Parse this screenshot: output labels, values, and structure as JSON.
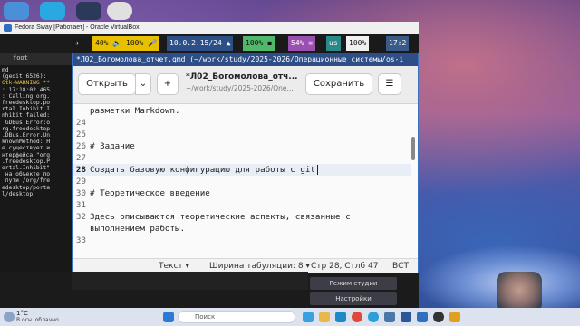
{
  "desktop": {
    "icons": [
      {
        "label": "Ko",
        "color": "#4a90d9"
      },
      {
        "label": "",
        "color": "#2aa8e0"
      },
      {
        "label": "",
        "color": "#2b3a5a"
      },
      {
        "label": "",
        "color": "#e0e0e0"
      },
      {
        "label": "",
        "color": "#c0392b"
      }
    ]
  },
  "vbox": {
    "title": "Fedora Sway [Работает] - Oracle VirtualBox",
    "controls": "— ❐ ✕"
  },
  "swaybar": {
    "segments": [
      {
        "text": "✈",
        "bg": "#1a1a1a",
        "fg": "#ddd"
      },
      {
        "text": "40% 🔈 100% 🎤",
        "bg": "#e8c000",
        "fg": "#111"
      },
      {
        "text": "10.0.2.15/24 ▲",
        "bg": "#2b4f86",
        "fg": "#fff"
      },
      {
        "text": "100% ◼",
        "bg": "#4fb86a",
        "fg": "#111"
      },
      {
        "text": "54% ≡",
        "bg": "#9b4fb0",
        "fg": "#fff"
      },
      {
        "text": "us",
        "bg": "#2a8a8a",
        "fg": "#fff"
      },
      {
        "text": "100%",
        "bg": "#f0f0f0",
        "fg": "#111"
      },
      {
        "text": "17:2",
        "bg": "#3a5a8a",
        "fg": "#fff"
      }
    ]
  },
  "terminal": {
    "title": "foot",
    "lines": [
      "md",
      "",
      "(gedit:6526):",
      "Gtk-WARNING **",
      ": 17:18:02.465",
      ": Calling org.",
      "freedesktop.po",
      "rtal.Inhibit.I",
      "nhibit failed:",
      " GDBus.Error:o",
      "rg.freedesktop",
      ".DBus.Error.Un",
      "knownMethod: Н",
      "е существует и",
      "нтерфейса \"org",
      ".freedesktop.P",
      "ortal.Inhibit\"",
      " на объекте по",
      " пути /org/fre",
      "edesktop/porta",
      "l/desktop"
    ]
  },
  "gedit": {
    "window_title": "*Л02_Богомолова_отчет.qmd (~/work/study/2025-2026/Операционные системы/os-i",
    "open_label": "Открыть",
    "open_dropdown": "⌄",
    "new_tab": "+",
    "doc_title": "*Л02_Богомолова_отч...",
    "doc_path": "~/work/study/2025-2026/One...",
    "save_label": "Сохранить",
    "menu_icon": "☰",
    "lines": [
      {
        "num": "",
        "text": "разметки Markdown.",
        "current": false
      },
      {
        "num": "24",
        "text": "",
        "current": false
      },
      {
        "num": "25",
        "text": "",
        "current": false
      },
      {
        "num": "26",
        "text": "# Задание",
        "current": false
      },
      {
        "num": "27",
        "text": "",
        "current": false
      },
      {
        "num": "28",
        "text": "Создать базовую конфигурацию для работы с git",
        "current": true
      },
      {
        "num": "29",
        "text": "",
        "current": false
      },
      {
        "num": "30",
        "text": "# Теоретическое введение",
        "current": false
      },
      {
        "num": "31",
        "text": "",
        "current": false
      },
      {
        "num": "32",
        "text": "Здесь описываются теоретические аспекты, связанные с",
        "current": false
      },
      {
        "num": "",
        "text": "выполнением работы.",
        "current": false
      },
      {
        "num": "33",
        "text": "",
        "current": false
      }
    ],
    "status": {
      "language": "Текст ▾",
      "tab_width": "Ширина табуляции: 8 ▾",
      "position": "Стр 28, Стлб 47",
      "mode": "ВСТ"
    }
  },
  "obs": {
    "studio_mode": "Режим студии",
    "settings": "Настройки"
  },
  "taskbar": {
    "temperature": "1°C",
    "weather": "В осн. облачно",
    "search_placeholder": "Поиск",
    "apps": [
      {
        "name": "windows",
        "color": "#2a7ad8"
      },
      {
        "name": "search",
        "color": "#fff"
      },
      {
        "name": "widgets",
        "color": "#3aa0e0"
      },
      {
        "name": "explorer",
        "color": "#e8b84a"
      },
      {
        "name": "edge",
        "color": "#1e88c8"
      },
      {
        "name": "chrome",
        "color": "#e04a3a"
      },
      {
        "name": "telegram",
        "color": "#2aa0d8"
      },
      {
        "name": "vk",
        "color": "#4a76a8"
      },
      {
        "name": "word",
        "color": "#2b5797"
      },
      {
        "name": "virtualbox",
        "color": "#2f6fbf"
      },
      {
        "name": "obs",
        "color": "#333"
      },
      {
        "name": "yandex",
        "color": "#e0a020"
      }
    ]
  }
}
